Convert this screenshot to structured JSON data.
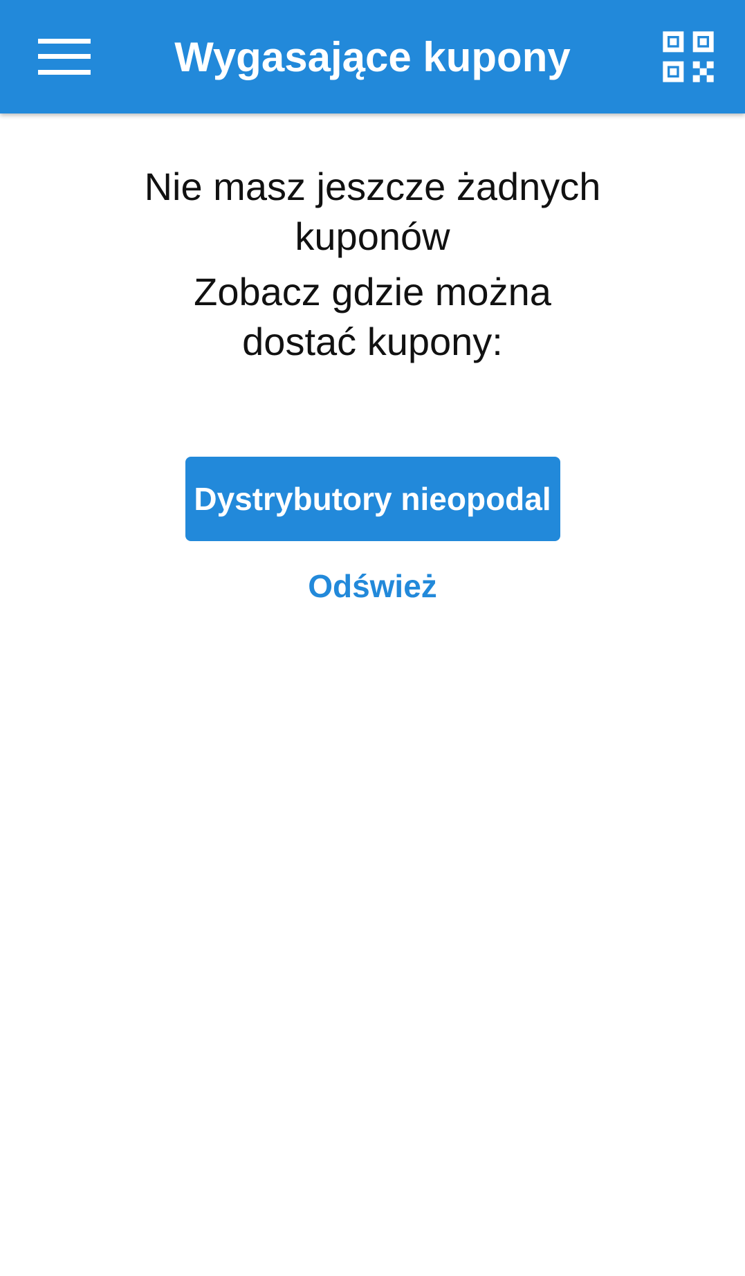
{
  "appbar": {
    "title": "Wygasające kupony",
    "menu_icon": "hamburger-menu-icon",
    "qr_icon": "qr-code-icon",
    "background_color": "#2289da"
  },
  "empty_state": {
    "message_line1": "Nie masz jeszcze żadnych kuponów",
    "message_line2": "Zobacz gdzie można dostać kupony:"
  },
  "actions": {
    "primary_label": "Dystrybutory nieopodal",
    "refresh_label": "Odśwież",
    "accent_color": "#2289da"
  }
}
